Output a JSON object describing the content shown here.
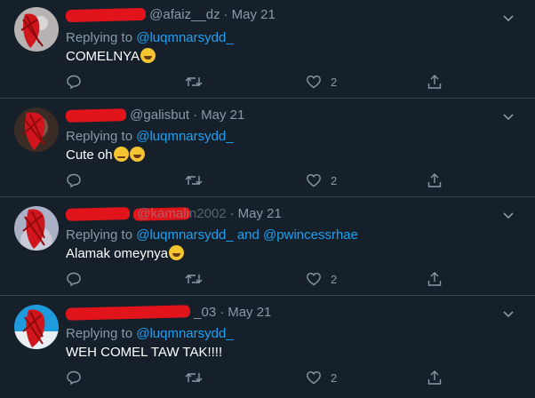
{
  "tweets": [
    {
      "handle": "@afaiz__dz",
      "date": "May 21",
      "replying_prefix": "Replying to",
      "reply_to": [
        "@luqmnarsydd_"
      ],
      "reply_joiner": "",
      "text": "COMELNYA",
      "emojis": [
        "rofl"
      ],
      "likes": "2",
      "avatar_color": "#b7b3b3"
    },
    {
      "handle": "@galisbut",
      "date": "May 21",
      "replying_prefix": "Replying to",
      "reply_to": [
        "@luqmnarsydd_"
      ],
      "reply_joiner": "",
      "text": "Cute oh",
      "emojis": [
        "roll-eyes",
        "rofl"
      ],
      "likes": "2",
      "avatar_color": "#3a2c24"
    },
    {
      "handle": "@kamalin2002",
      "date": "May 21",
      "replying_prefix": "Replying to",
      "reply_to": [
        "@luqmnarsydd_",
        "@pwincessrhae"
      ],
      "reply_joiner": "and",
      "text": "Alamak omeynya",
      "emojis": [
        "joy"
      ],
      "likes": "2",
      "avatar_color": "#aab0c6"
    },
    {
      "handle": "_03",
      "date": "May 21",
      "replying_prefix": "Replying to",
      "reply_to": [
        "@luqmnarsydd_"
      ],
      "reply_joiner": "",
      "text": "WEH COMEL TAW TAK!!!!",
      "emojis": [],
      "likes": "2",
      "avatar_color": "#1e9bdc"
    }
  ],
  "icons": {
    "reply": "reply-icon",
    "retweet": "retweet-icon",
    "like": "heart-icon",
    "share": "share-icon",
    "more": "chevron-down-icon"
  },
  "colors": {
    "background": "#15202b",
    "divider": "#38444d",
    "muted": "#8899a6",
    "link": "#1da1f2",
    "redaction": "#e0141a"
  }
}
